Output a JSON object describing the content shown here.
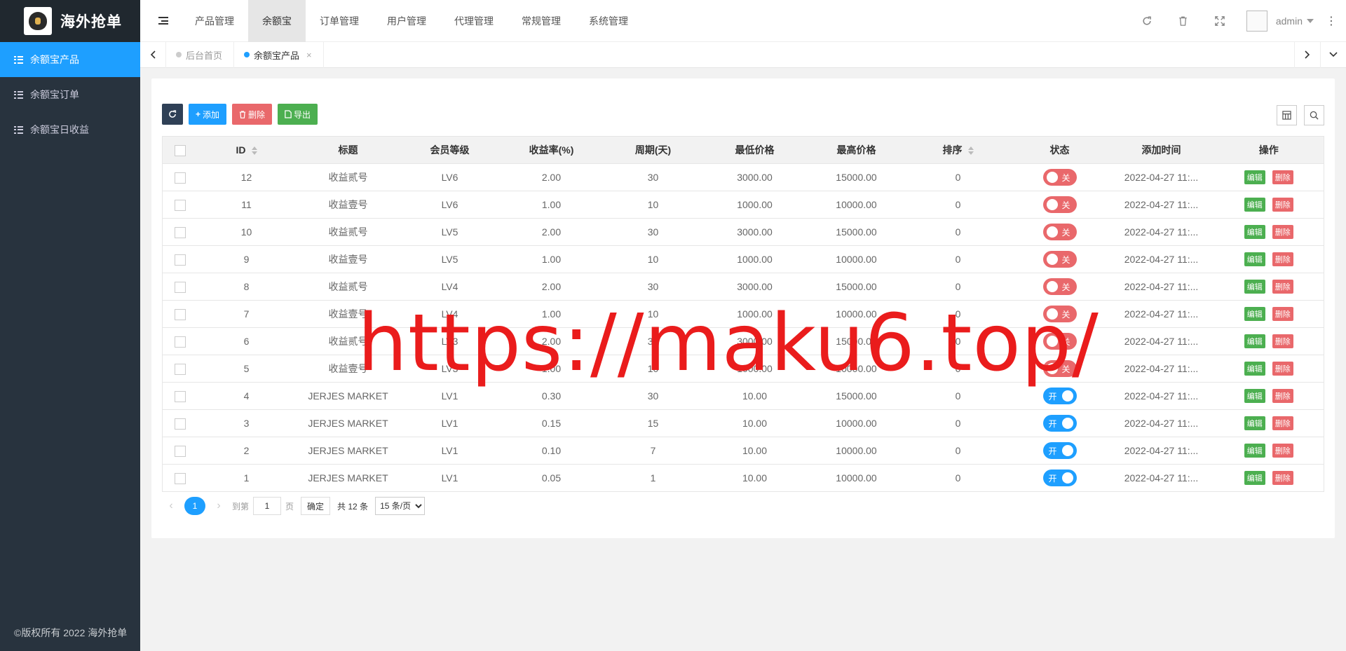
{
  "app": {
    "title": "海外抢单",
    "copyright": "©版权所有 2022 海外抢单"
  },
  "sidebar": {
    "items": [
      {
        "label": "余额宝产品",
        "active": true
      },
      {
        "label": "余额宝订单",
        "active": false
      },
      {
        "label": "余额宝日收益",
        "active": false
      }
    ]
  },
  "topnav": {
    "items": [
      {
        "label": "产品管理"
      },
      {
        "label": "余额宝"
      },
      {
        "label": "订单管理"
      },
      {
        "label": "用户管理"
      },
      {
        "label": "代理管理"
      },
      {
        "label": "常规管理"
      },
      {
        "label": "系统管理"
      }
    ],
    "active_index": 1,
    "user": "admin",
    "icons": [
      "refresh-icon",
      "trash-icon",
      "fullscreen-icon"
    ]
  },
  "tabs": [
    {
      "label": "后台首页",
      "active": false
    },
    {
      "label": "余额宝产品",
      "active": true,
      "close": "×"
    }
  ],
  "toolbar": {
    "add": "添加",
    "delete": "删除",
    "export": "导出"
  },
  "table": {
    "columns": [
      "ID",
      "标题",
      "会员等级",
      "收益率(%)",
      "周期(天)",
      "最低价格",
      "最高价格",
      "排序",
      "状态",
      "添加时间",
      "操作"
    ],
    "rows": [
      {
        "id": "12",
        "title": "收益贰号",
        "level": "LV6",
        "rate": "2.00",
        "period": "30",
        "min": "3000.00",
        "max": "15000.00",
        "sort": "0",
        "status": "关",
        "on": false,
        "time": "2022-04-27 11:..."
      },
      {
        "id": "11",
        "title": "收益壹号",
        "level": "LV6",
        "rate": "1.00",
        "period": "10",
        "min": "1000.00",
        "max": "10000.00",
        "sort": "0",
        "status": "关",
        "on": false,
        "time": "2022-04-27 11:..."
      },
      {
        "id": "10",
        "title": "收益贰号",
        "level": "LV5",
        "rate": "2.00",
        "period": "30",
        "min": "3000.00",
        "max": "15000.00",
        "sort": "0",
        "status": "关",
        "on": false,
        "time": "2022-04-27 11:..."
      },
      {
        "id": "9",
        "title": "收益壹号",
        "level": "LV5",
        "rate": "1.00",
        "period": "10",
        "min": "1000.00",
        "max": "10000.00",
        "sort": "0",
        "status": "关",
        "on": false,
        "time": "2022-04-27 11:..."
      },
      {
        "id": "8",
        "title": "收益贰号",
        "level": "LV4",
        "rate": "2.00",
        "period": "30",
        "min": "3000.00",
        "max": "15000.00",
        "sort": "0",
        "status": "关",
        "on": false,
        "time": "2022-04-27 11:..."
      },
      {
        "id": "7",
        "title": "收益壹号",
        "level": "LV4",
        "rate": "1.00",
        "period": "10",
        "min": "1000.00",
        "max": "10000.00",
        "sort": "0",
        "status": "关",
        "on": false,
        "time": "2022-04-27 11:..."
      },
      {
        "id": "6",
        "title": "收益贰号",
        "level": "LV3",
        "rate": "2.00",
        "period": "30",
        "min": "3000.00",
        "max": "15000.00",
        "sort": "0",
        "status": "关",
        "on": false,
        "time": "2022-04-27 11:..."
      },
      {
        "id": "5",
        "title": "收益壹号",
        "level": "LV3",
        "rate": "1.00",
        "period": "10",
        "min": "1000.00",
        "max": "10000.00",
        "sort": "0",
        "status": "关",
        "on": false,
        "time": "2022-04-27 11:..."
      },
      {
        "id": "4",
        "title": "JERJES MARKET",
        "level": "LV1",
        "rate": "0.30",
        "period": "30",
        "min": "10.00",
        "max": "15000.00",
        "sort": "0",
        "status": "开",
        "on": true,
        "time": "2022-04-27 11:..."
      },
      {
        "id": "3",
        "title": "JERJES MARKET",
        "level": "LV1",
        "rate": "0.15",
        "period": "15",
        "min": "10.00",
        "max": "10000.00",
        "sort": "0",
        "status": "开",
        "on": true,
        "time": "2022-04-27 11:..."
      },
      {
        "id": "2",
        "title": "JERJES MARKET",
        "level": "LV1",
        "rate": "0.10",
        "period": "7",
        "min": "10.00",
        "max": "10000.00",
        "sort": "0",
        "status": "开",
        "on": true,
        "time": "2022-04-27 11:..."
      },
      {
        "id": "1",
        "title": "JERJES MARKET",
        "level": "LV1",
        "rate": "0.05",
        "period": "1",
        "min": "10.00",
        "max": "10000.00",
        "sort": "0",
        "status": "开",
        "on": true,
        "time": "2022-04-27 11:..."
      }
    ],
    "edit_label": "编辑",
    "delete_label": "删除"
  },
  "pager": {
    "current": "1",
    "goto_label": "到第",
    "page_value": "1",
    "page_unit": "页",
    "confirm": "确定",
    "total": "共 12 条",
    "per_page": "15 条/页"
  },
  "watermark": "https://maku6.top/",
  "colors": {
    "primary": "#1e9fff",
    "danger": "#e9686b",
    "success": "#4caf50",
    "sidebar": "#28333e",
    "watermark": "#ea1c1c"
  }
}
